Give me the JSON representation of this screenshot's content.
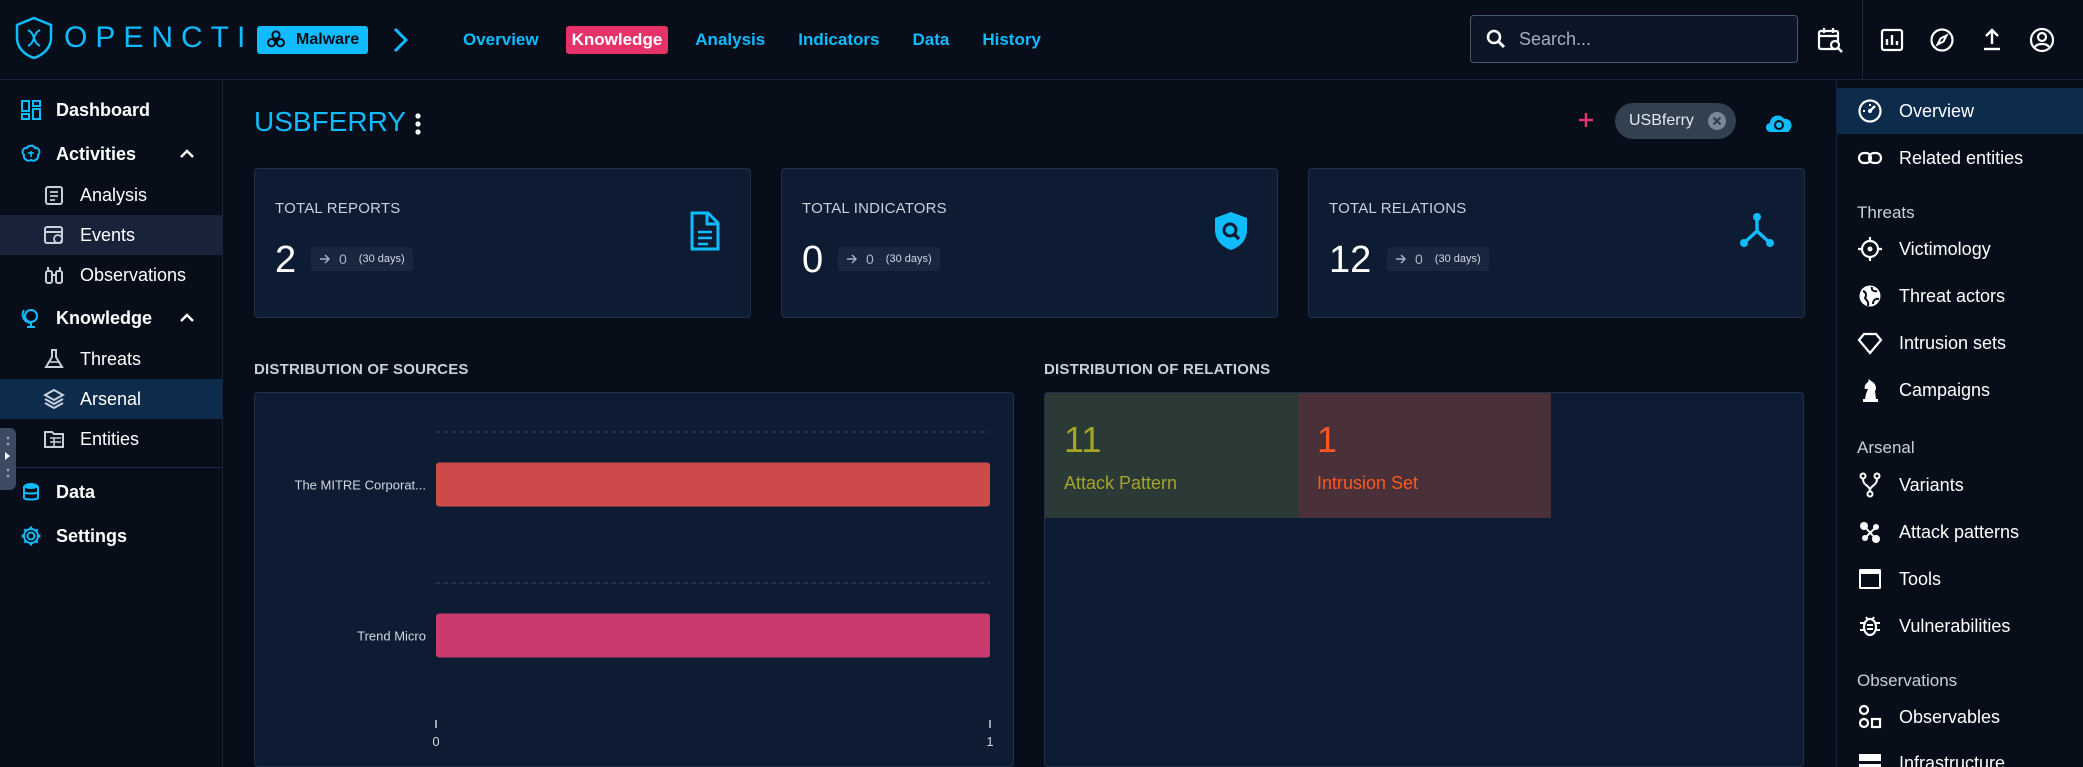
{
  "app": {
    "logo_text": "OPENCTI"
  },
  "topbar": {
    "entity_type_badge": "Malware",
    "tabs": [
      {
        "label": "Overview"
      },
      {
        "label": "Knowledge",
        "active": true
      },
      {
        "label": "Analysis"
      },
      {
        "label": "Indicators"
      },
      {
        "label": "Data"
      },
      {
        "label": "History"
      }
    ],
    "search_placeholder": "Search..."
  },
  "sidebar": {
    "items": [
      {
        "label": "Dashboard"
      },
      {
        "label": "Activities"
      },
      {
        "label": "Analysis"
      },
      {
        "label": "Events"
      },
      {
        "label": "Observations"
      },
      {
        "label": "Knowledge"
      },
      {
        "label": "Threats"
      },
      {
        "label": "Arsenal"
      },
      {
        "label": "Entities"
      },
      {
        "label": "Data"
      },
      {
        "label": "Settings"
      }
    ]
  },
  "entity": {
    "name": "USBFERRY",
    "label_chip": "USBferry"
  },
  "cards": [
    {
      "title": "TOTAL REPORTS",
      "value": "2",
      "delta": "0",
      "period": "(30 days)",
      "icon": "file-document-icon"
    },
    {
      "title": "TOTAL INDICATORS",
      "value": "0",
      "delta": "0",
      "period": "(30 days)",
      "icon": "shield-search-icon"
    },
    {
      "title": "TOTAL RELATIONS",
      "value": "12",
      "delta": "0",
      "period": "(30 days)",
      "icon": "graph-outline-icon"
    }
  ],
  "sections": {
    "sources_title": "DISTRIBUTION OF SOURCES",
    "relations_title": "DISTRIBUTION OF RELATIONS"
  },
  "chart_data": {
    "type": "bar",
    "orientation": "horizontal",
    "categories": [
      "The MITRE Corporat...",
      "Trend Micro"
    ],
    "values": [
      1,
      1
    ],
    "colors": [
      "#cd4a4a",
      "#c93a6e"
    ],
    "xlim": [
      0,
      1
    ],
    "xticks": [
      "0",
      "1"
    ],
    "grid": true
  },
  "relations_treemap": [
    {
      "value": "11",
      "label": "Attack Pattern",
      "color": "#a5a526",
      "bg": "#2b3a36"
    },
    {
      "value": "1",
      "label": "Intrusion Set",
      "color": "#ff5722",
      "bg": "#4a3038"
    }
  ],
  "rightbar": {
    "overview": "Overview",
    "related": "Related entities",
    "threats_head": "Threats",
    "victimology": "Victimology",
    "threat_actors": "Threat actors",
    "intrusion_sets": "Intrusion sets",
    "campaigns": "Campaigns",
    "arsenal_head": "Arsenal",
    "variants": "Variants",
    "attack_patterns": "Attack patterns",
    "tools": "Tools",
    "vulnerabilities": "Vulnerabilities",
    "observations_head": "Observations",
    "observables": "Observables",
    "infrastructure": "Infrastructure"
  },
  "colors": {
    "accent": "#0fbcff",
    "active_tab": "#e5336a",
    "background": "#070d19",
    "panel": "#0d1c33"
  }
}
